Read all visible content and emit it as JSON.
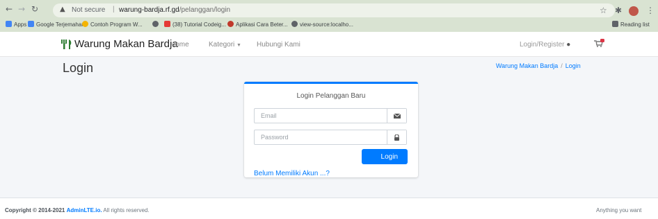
{
  "browser": {
    "security_label": "Not secure",
    "url_host": "warung-bardja.rf.gd",
    "url_path": "/pelanggan/login",
    "bookmarks": [
      {
        "label": "Apps",
        "color": "#4285f4"
      },
      {
        "label": "Google Terjemahan",
        "color": "#4285f4"
      },
      {
        "label": "Contoh Program W...",
        "color": "#f4b400"
      },
      {
        "label": "",
        "color": "#5f6368"
      },
      {
        "label": "(38) Tutorial Codeig...",
        "color": "#e53935"
      },
      {
        "label": "Aplikasi Cara Beter...",
        "color": "#c0392b"
      },
      {
        "label": "view-source:localho...",
        "color": "#5f6368"
      }
    ],
    "reading_list": "Reading list"
  },
  "navbar": {
    "brand": "Warung Makan Bardja",
    "links": {
      "home": "Home",
      "kategori": "Kategori",
      "contact": "Hubungi Kami"
    },
    "login_register": "Login/Register",
    "cart_icon": "cart-icon",
    "brand_color": "#2e7d32"
  },
  "page": {
    "title": "Login",
    "breadcrumb": {
      "home": "Warung Makan Bardja",
      "current": "Login"
    }
  },
  "login_card": {
    "title": "Login Pelanggan Baru",
    "email_placeholder": "Email",
    "email_value": "",
    "password_placeholder": "Password",
    "password_value": "",
    "login_button": "Login",
    "register_link": "Belum Memiliki Akun ...?",
    "accent_color": "#007bff"
  },
  "footer": {
    "copyright_prefix": "Copyright © 2014-2021",
    "copyright_brand": "AdminLTE.io.",
    "copyright_suffix": "All rights reserved.",
    "right_text": "Anything you want"
  }
}
